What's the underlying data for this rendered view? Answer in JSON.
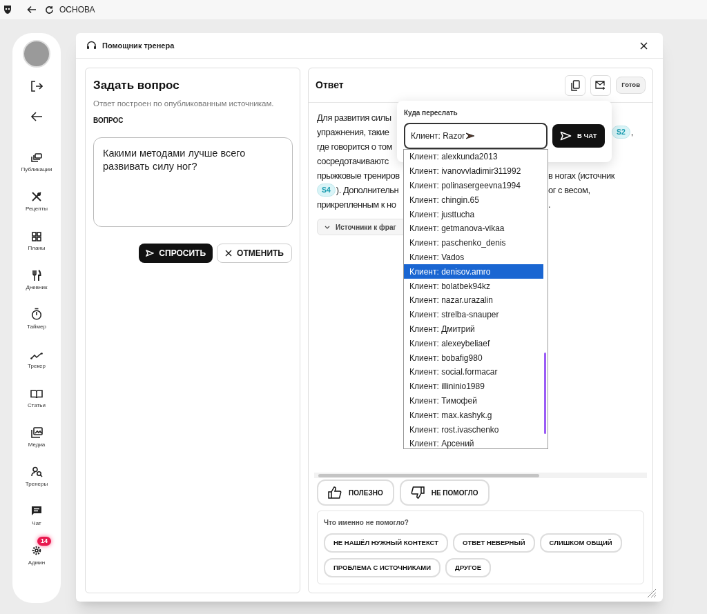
{
  "browser_bar": {
    "title": "ОСНОВА"
  },
  "sidebar": {
    "top_actions": [
      {
        "kind": "logout"
      },
      {
        "kind": "back"
      }
    ],
    "items": [
      {
        "kind": "publications",
        "label": "Публикации"
      },
      {
        "kind": "recipes",
        "label": "Рецепты"
      },
      {
        "kind": "plans",
        "label": "Планы"
      },
      {
        "kind": "diary",
        "label": "Дневник"
      },
      {
        "kind": "timer",
        "label": "Таймер"
      },
      {
        "kind": "tracker",
        "label": "Трекер"
      },
      {
        "kind": "articles",
        "label": "Статьи"
      },
      {
        "kind": "media",
        "label": "Медиа"
      },
      {
        "kind": "trainers",
        "label": "Тренеры"
      },
      {
        "kind": "chat",
        "label": "Чат"
      },
      {
        "kind": "admin",
        "label": "Админ",
        "badge": "14"
      }
    ]
  },
  "dialog": {
    "title": "Помощник тренера"
  },
  "question_panel": {
    "title": "Задать вопрос",
    "subtitle": "Ответ построен по опубликованным источникам.",
    "field_label": "ВОПРОС",
    "question": "Какими методами лучше всего развивать силу ног?",
    "buttons": [
      {
        "kind": "primary",
        "label": "СПРОСИТЬ"
      },
      {
        "kind": "secondary",
        "label": "ОТМЕНИТЬ"
      }
    ]
  },
  "answer_panel": {
    "title": "Ответ",
    "status": "Готов",
    "lines": [
      {
        "kind": "beside-popup",
        "left": [
          {
            "kind": "text",
            "text": "Для развития силы"
          }
        ]
      },
      {
        "kind": "beside-popup",
        "left": [
          {
            "kind": "text",
            "text": "упражнения, такие"
          }
        ],
        "right": [
          {
            "kind": "source",
            "text": "S2"
          },
          {
            "kind": "text",
            "text": ","
          }
        ]
      },
      {
        "kind": "beside-popup",
        "left": [
          {
            "kind": "text",
            "text": "где говорится о том"
          }
        ]
      },
      {
        "kind": "beside-list",
        "left": [
          {
            "kind": "text",
            "text": "сосредотачиваютс"
          }
        ]
      },
      {
        "kind": "beside-list",
        "left": [
          {
            "kind": "text",
            "text": "прыжковые трениров"
          }
        ],
        "right": [
          {
            "kind": "text",
            "text": "в ногах (источник"
          }
        ]
      },
      {
        "kind": "beside-list",
        "left": [
          {
            "kind": "source",
            "text": "S4"
          },
          {
            "kind": "text",
            "text": "). Дополнительн"
          }
        ],
        "right": [
          {
            "kind": "text",
            "text": "ог с весом,"
          }
        ]
      },
      {
        "kind": "beside-list",
        "left": [
          {
            "kind": "text",
            "text": "прикрепленным к но"
          }
        ],
        "right": [
          {
            "kind": "text",
            "text": "."
          }
        ]
      }
    ],
    "sources_toggle": "Источники к фраг",
    "feedback": [
      {
        "kind": "up",
        "label": "ПОЛЕЗНО"
      },
      {
        "kind": "down",
        "label": "НЕ ПОМОГЛО"
      }
    ],
    "reasons": {
      "title": "Что именно не помогло?",
      "options": [
        "НЕ НАШЁЛ НУЖНЫЙ КОНТЕКСТ",
        "ОТВЕТ НЕВЕРНЫЙ",
        "СЛИШКОМ ОБЩИЙ",
        "ПРОБЛЕМА С ИСТОЧНИКАМИ",
        "ДРУГОЕ"
      ]
    }
  },
  "forward_popup": {
    "title": "Куда переслать",
    "value": "Клиент: Razor",
    "send_label": "В ЧАТ",
    "options": [
      {
        "label": "Клиент: alexkunda2013",
        "selected": false
      },
      {
        "label": "Клиент: ivanovvladimir311992",
        "selected": false
      },
      {
        "label": "Клиент: polinasergeevna1994",
        "selected": false
      },
      {
        "label": "Клиент: chingin.65",
        "selected": false
      },
      {
        "label": "Клиент: justtucha",
        "selected": false
      },
      {
        "label": "Клиент: getmanova-vikaa",
        "selected": false
      },
      {
        "label": "Клиент: paschenko_denis",
        "selected": false
      },
      {
        "label": "Клиент: Vados",
        "selected": false
      },
      {
        "label": "Клиент: denisov.amro",
        "selected": true
      },
      {
        "label": "Клиент: bolatbek94kz",
        "selected": false
      },
      {
        "label": "Клиент: nazar.urazalin",
        "selected": false
      },
      {
        "label": "Клиент: strelba-snauper",
        "selected": false
      },
      {
        "label": "Клиент: Дмитрий",
        "selected": false
      },
      {
        "label": "Клиент: alexeybeliaef",
        "selected": false
      },
      {
        "label": "Клиент: bobafig980",
        "selected": false
      },
      {
        "label": "Клиент: social.formacar",
        "selected": false
      },
      {
        "label": "Клиент: illininio1989",
        "selected": false
      },
      {
        "label": "Клиент: Тимофей",
        "selected": false
      },
      {
        "label": "Клиент: max.kashyk.g",
        "selected": false
      },
      {
        "label": "Клиент: rost.ivaschenko",
        "selected": false
      },
      {
        "label": "Клиент: Арсений",
        "selected": false
      }
    ]
  }
}
